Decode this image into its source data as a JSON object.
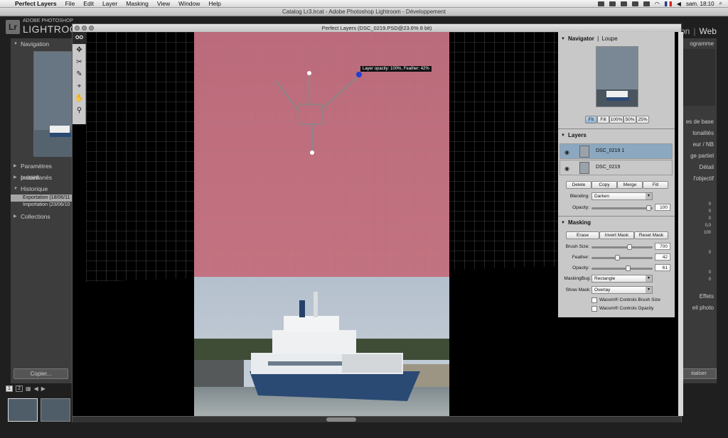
{
  "menubar": {
    "app_name": "Perfect Layers",
    "items": [
      "File",
      "Edit",
      "Layer",
      "Masking",
      "View",
      "Window",
      "Help"
    ],
    "clock": "sam. 18:10"
  },
  "lightroom": {
    "window_title": "Catalog Lr3.lrcat - Adobe Photoshop Lightroom - Développement",
    "brand_small": "ADOBE PHOTOSHOP",
    "brand_big": "LIGHTROOM",
    "logo": "Lr",
    "modules": [
      "on",
      "Web"
    ],
    "left_panel": {
      "navigation": "Navigation",
      "presets": "Paramètres prédéfi",
      "snapshots": "Instantanés",
      "history": "Historique",
      "history_items": [
        "Exportation  (18/06/11",
        "Importation (23/06/10 1"
      ],
      "collections": "Collections",
      "copy_button": "Copier..."
    },
    "right_panel": {
      "labels": [
        "ogramme",
        "es de base",
        "tonalités",
        "eur / NB",
        "ge partiel",
        "Détail",
        "l'objectif",
        "Effets",
        "eil photo"
      ],
      "values": [
        "0",
        "0",
        "0",
        "0,0",
        "100",
        "0",
        "0",
        "0"
      ],
      "init_button": "itialiser"
    },
    "filmstrip": {
      "pages": [
        "1",
        "2"
      ]
    }
  },
  "perfect_layers": {
    "window_title": "Perfect Layers (DSC_0219.PSD@23.6% 8 bit)",
    "tooltip": "Layer opacity: 100%, Feather: 42%",
    "navigator": {
      "title": "Navigator",
      "loupe": "Loupe",
      "zoom_buttons": [
        "Fit",
        "Fill",
        "100%",
        "50%",
        "25%"
      ]
    },
    "layers": {
      "title": "Layers",
      "items": [
        {
          "name": "DSC_0219 1",
          "selected": true
        },
        {
          "name": "DSC_0219",
          "selected": false
        }
      ],
      "buttons": [
        "Delete",
        "Copy",
        "Merge",
        "Fill"
      ],
      "blending_label": "Blending:",
      "blending_value": "Darken",
      "opacity_label": "Opacity:",
      "opacity_value": "100",
      "opacity_fraction": 0.97
    },
    "masking": {
      "title": "Masking",
      "buttons": [
        "Erase",
        "Invert Mask",
        "Reset Mask"
      ],
      "brush_size_label": "Brush Size:",
      "brush_size_value": "700",
      "brush_size_fraction": 0.63,
      "feather_label": "Feather:",
      "feather_value": "42",
      "feather_fraction": 0.42,
      "opacity_label": "Opacity:",
      "opacity_value": "61",
      "opacity_fraction": 0.61,
      "maskingbug_label": "MaskingBug:",
      "maskingbug_value": "Rectangle",
      "showmask_label": "Show Mask:",
      "showmask_value": "Overlay",
      "wacom_brush": "Wacom® Controls Brush Size",
      "wacom_opacity": "Wacom® Controls Opacity"
    }
  }
}
